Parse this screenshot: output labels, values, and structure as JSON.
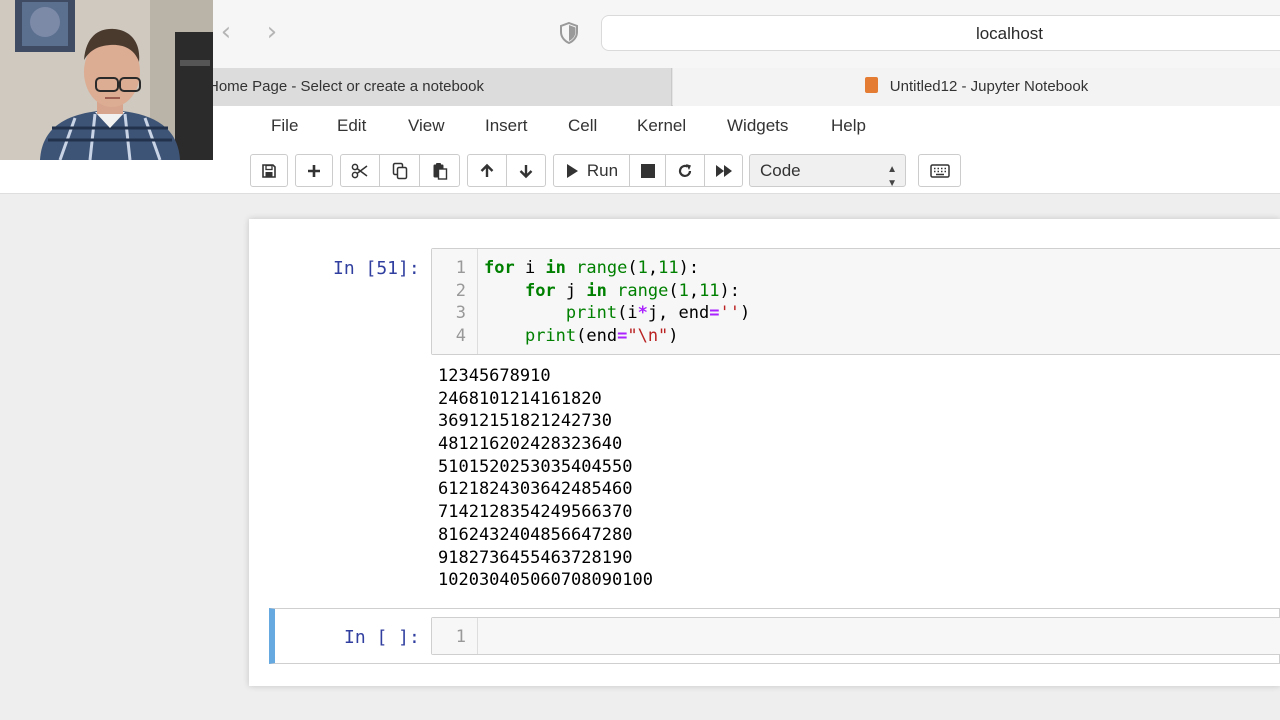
{
  "browser": {
    "url": "localhost",
    "tabs": [
      {
        "label": "Home Page - Select or create a notebook"
      },
      {
        "label": "Untitled12 - Jupyter Notebook"
      }
    ]
  },
  "menu": [
    "File",
    "Edit",
    "View",
    "Insert",
    "Cell",
    "Kernel",
    "Widgets",
    "Help"
  ],
  "toolbar": {
    "run_label": "Run",
    "cell_type": "Code",
    "icons": [
      "save-icon",
      "plus-icon",
      "scissors-icon",
      "copy-icon",
      "paste-icon",
      "arrow-up-icon",
      "arrow-down-icon",
      "play-icon",
      "stop-icon",
      "restart-icon",
      "fast-forward-icon",
      "keyboard-icon"
    ]
  },
  "cells": [
    {
      "prompt": "In [51]:",
      "line_numbers": [
        "1",
        "2",
        "3",
        "4"
      ],
      "code": [
        "for i in range(1,11):",
        "    for j in range(1,11):",
        "        print(i*j, end='')",
        "    print(end=\"\\n\")"
      ],
      "output": [
        "12345678910",
        "2468101214161820",
        "36912151821242730",
        "481216202428323640",
        "5101520253035404550",
        "6121824303642485460",
        "7142128354249566370",
        "8162432404856647280",
        "9182736455463728190",
        "102030405060708090100"
      ]
    },
    {
      "prompt": "In [ ]:",
      "line_numbers": [
        "1"
      ]
    }
  ],
  "colors": {
    "prompt": "#303f9f",
    "keyword": "#008000",
    "string": "#ba2121",
    "operator": "#aa22ff",
    "selected_cell_border": "#66a8e0",
    "notebook_tab_icon": "#e47c34"
  }
}
